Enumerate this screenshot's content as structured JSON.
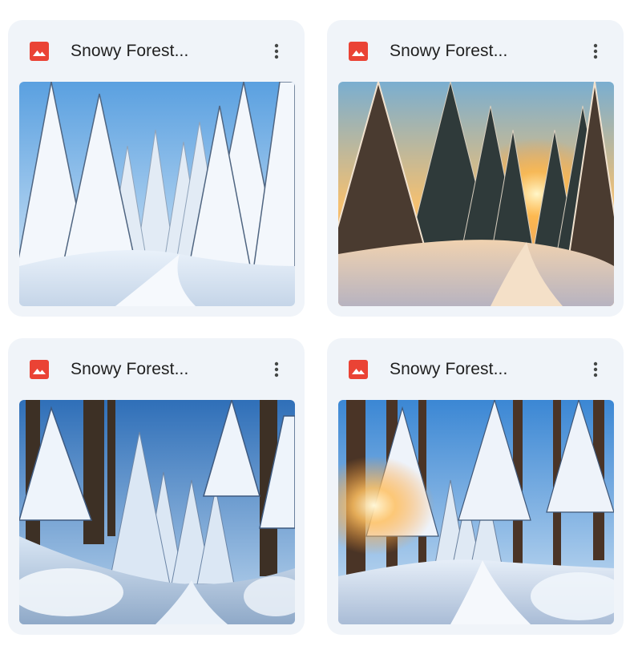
{
  "files": [
    {
      "title": "Snowy Forest...",
      "file_icon": "image-file-icon",
      "menu_icon": "more-vert-icon",
      "thumbnail": "snowy-forest-daylight"
    },
    {
      "title": "Snowy Forest...",
      "file_icon": "image-file-icon",
      "menu_icon": "more-vert-icon",
      "thumbnail": "snowy-forest-sunset"
    },
    {
      "title": "Snowy Forest...",
      "file_icon": "image-file-icon",
      "menu_icon": "more-vert-icon",
      "thumbnail": "snowy-forest-path-blue"
    },
    {
      "title": "Snowy Forest...",
      "file_icon": "image-file-icon",
      "menu_icon": "more-vert-icon",
      "thumbnail": "snowy-forest-sunburst"
    }
  ],
  "colors": {
    "card_background": "#f0f4f9",
    "file_icon": "#ea4335",
    "title_text": "#1f1f1f",
    "menu_icon": "#444746"
  }
}
